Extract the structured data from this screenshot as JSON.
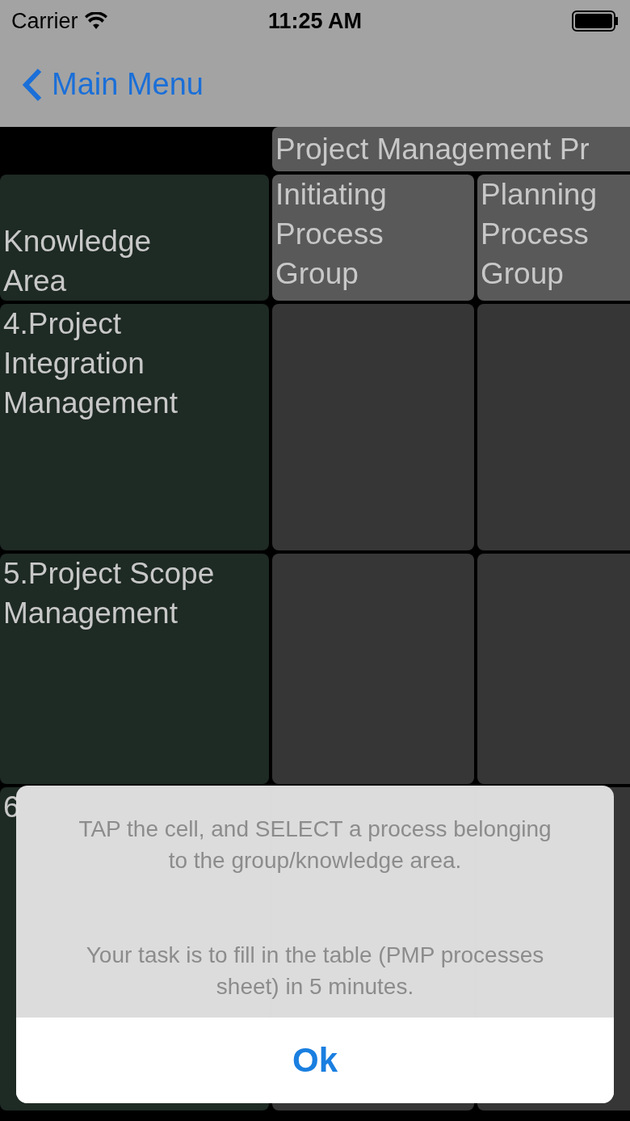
{
  "status_bar": {
    "carrier": "Carrier",
    "time": "11:25 AM"
  },
  "nav": {
    "back": "Main Menu"
  },
  "table": {
    "group_header": "Project Management Pr",
    "corner": "Knowledge\nArea",
    "columns": [
      "Initiating\nProcess\nGroup",
      "Planning\nProcess\nGroup"
    ],
    "rows": [
      {
        "label": "4.Project\nIntegration\nManagement"
      },
      {
        "label": "5.Project Scope\nManagement"
      },
      {
        "label": "6"
      }
    ]
  },
  "alert": {
    "messages": [
      "TAP the cell, and SELECT a process belonging to the group/knowledge area.",
      "Your task is to fill in the table (PMP processes sheet) in 5 minutes."
    ],
    "button": "Ok"
  }
}
